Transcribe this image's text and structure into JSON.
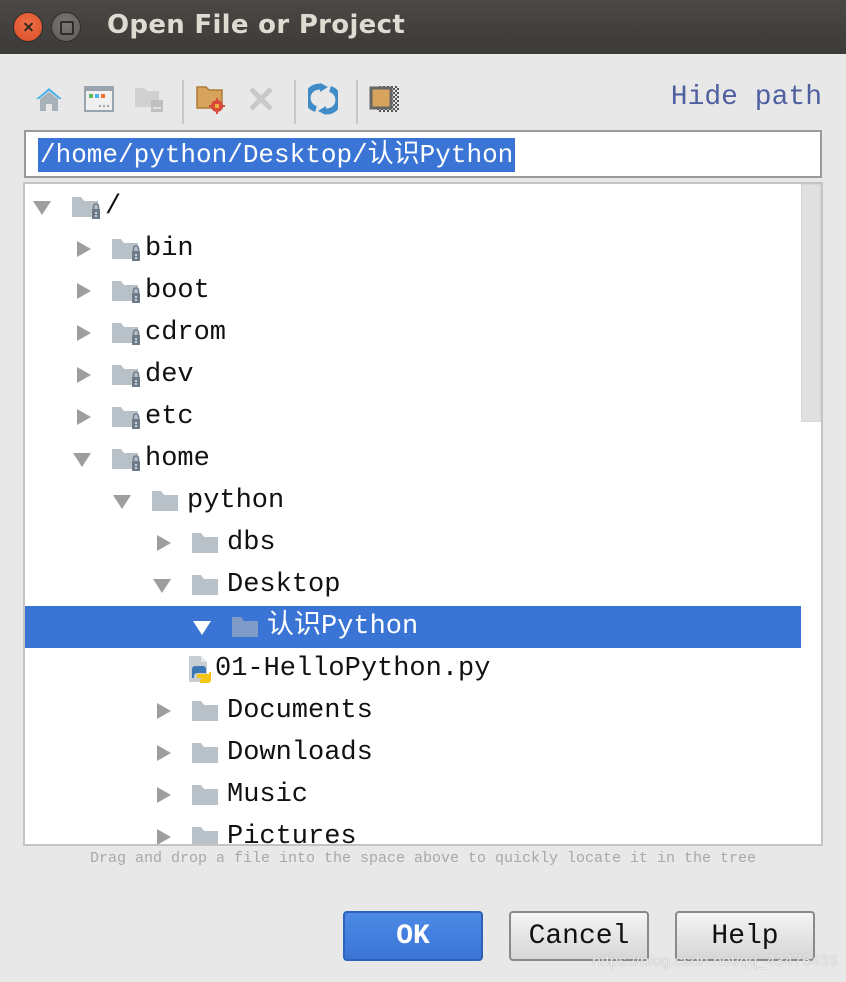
{
  "window": {
    "title": "Open File or Project"
  },
  "toolbar": {
    "icons": [
      "home-icon",
      "desktop-icon",
      "project-folder-icon",
      "new-folder-icon",
      "delete-icon",
      "refresh-icon",
      "show-hidden-icon"
    ],
    "hide_path_label": "Hide path"
  },
  "path_field": {
    "value": "/home/python/Desktop/认识Python"
  },
  "tree": {
    "nodes": [
      {
        "label": "/",
        "level": 0,
        "state": "expanded",
        "locked": true
      },
      {
        "label": "bin",
        "level": 1,
        "state": "collapsed",
        "locked": true
      },
      {
        "label": "boot",
        "level": 1,
        "state": "collapsed",
        "locked": true
      },
      {
        "label": "cdrom",
        "level": 1,
        "state": "collapsed",
        "locked": true
      },
      {
        "label": "dev",
        "level": 1,
        "state": "collapsed",
        "locked": true
      },
      {
        "label": "etc",
        "level": 1,
        "state": "collapsed",
        "locked": true
      },
      {
        "label": "home",
        "level": 1,
        "state": "expanded",
        "locked": true
      },
      {
        "label": "python",
        "level": 2,
        "state": "expanded",
        "locked": false
      },
      {
        "label": "dbs",
        "level": 3,
        "state": "collapsed",
        "locked": false
      },
      {
        "label": "Desktop",
        "level": 3,
        "state": "expanded",
        "locked": false
      },
      {
        "label": "认识Python",
        "level": 4,
        "state": "expanded",
        "locked": false,
        "selected": true
      },
      {
        "label": "01-HelloPython.py",
        "level": 5,
        "type": "python-file"
      },
      {
        "label": "Documents",
        "level": 3,
        "state": "collapsed",
        "locked": false
      },
      {
        "label": "Downloads",
        "level": 3,
        "state": "collapsed",
        "locked": false
      },
      {
        "label": "Music",
        "level": 3,
        "state": "collapsed",
        "locked": false
      },
      {
        "label": "Pictures",
        "level": 3,
        "state": "collapsed",
        "locked": false
      }
    ]
  },
  "hint": "Drag and drop a file into the space above to quickly locate it in the tree",
  "buttons": {
    "ok": "OK",
    "cancel": "Cancel",
    "help": "Help"
  },
  "watermark": "https://blog.csdn.net/qq_43476433",
  "colors": {
    "selection": "#3a75d6",
    "link": "#4f5fa0",
    "folder": "#b8c0c8"
  }
}
